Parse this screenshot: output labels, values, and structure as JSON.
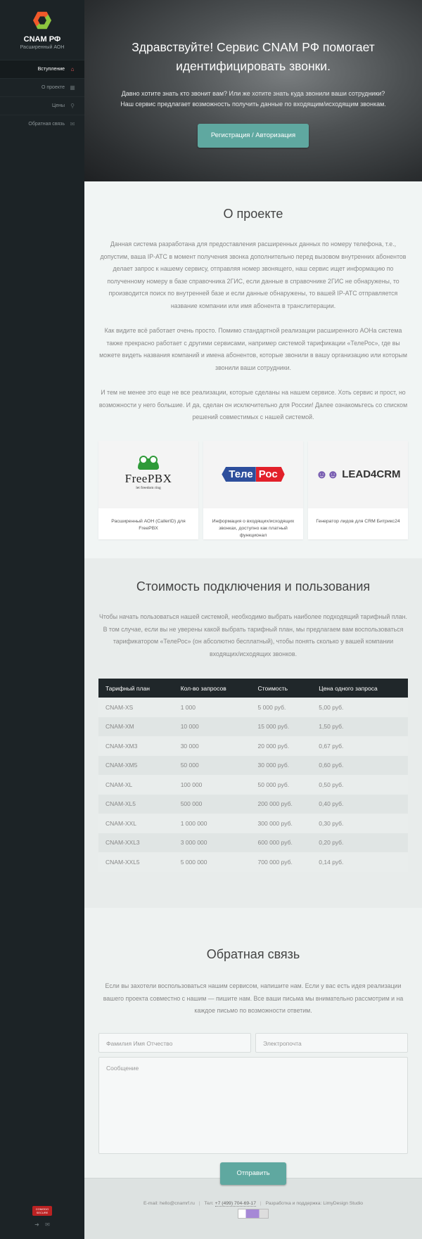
{
  "sidebar": {
    "brand": "CNAM РФ",
    "subtitle": "Расширенный АОН",
    "nav": [
      {
        "label": "Вступление",
        "icon": "home-icon"
      },
      {
        "label": "О проекте",
        "icon": "grid-icon"
      },
      {
        "label": "Цены",
        "icon": "search-icon"
      },
      {
        "label": "Обратная связь",
        "icon": "mail-icon"
      }
    ],
    "badge": "COMODO SECURE",
    "bottom_icons": [
      "login-icon",
      "mail-icon"
    ]
  },
  "hero": {
    "title": "Здравствуйте! Сервис CNAM РФ помогает идентифицировать звонки.",
    "line1": "Давно хотите знать кто звонит вам? Или же хотите знать куда звонили ваши сотрудники?",
    "line2": "Наш сервис предлагает возможность получить данные по входящим/исходящим звонкам.",
    "button": "Регистрация / Авторизация"
  },
  "about": {
    "title": "О проекте",
    "p1": "Данная система разработана для предоставления расширенных данных по номеру телефона, т.е., допустим, ваша IP-АТС в момент получения звонка дополнительно перед вызовом внутренних абонентов делает запрос к нашему сервису, отправляя номер звонящего, наш сервис ищет информацию по полученному номеру в базе справочника 2ГИС, если данные в справочнике 2ГИС не обнаружены, то производится поиск по внутренней базе и если данные обнаружены, то вашей IP-АТС отправляется название компании или имя абонента в транслитерации.",
    "p2": "Как видите всё работает очень просто. Помимо стандартной реализации расширенного АОНа система также прекрасно работает с другими сервисами, например системой тарификации «ТелеРос», где вы можете видеть названия компаний и имена абонентов, которые звонили в вашу организацию или которым звонили ваши сотрудники.",
    "p3": "И тем не менее это еще не все реализации, которые сделаны на нашем сервисе. Хоть сервис и прост, но возможности у него большие. И да, сделан он исключительно для России! Далее ознакомьтесь со списком решений совместимых с нашей системой.",
    "partners": [
      {
        "logo_name": "FreePBX",
        "logo_tag": "let freedom ring",
        "caption": "Расширенный АОН (CallerID) для FreePBX"
      },
      {
        "logo_left": "Теле",
        "logo_right": "Рос",
        "caption": "Информация о входящих/исходящих звонках, доступно как платный функционал"
      },
      {
        "logo_name": "LEAD4CRM",
        "caption": "Генератор лидов для CRM Битрикс24"
      }
    ]
  },
  "pricing": {
    "title": "Стоимость подключения и пользования",
    "intro": "Чтобы начать пользоваться нашей системой, необходимо выбрать наиболее подходящий тарифный план. В том случае, если вы не уверены какой выбрать тарифный план, мы предлагаем вам воспользоваться тарификатором «ТелеРос» (он абсолютно бесплатный), чтобы понять сколько у вашей компании входящих/исходящих звонков.",
    "headers": [
      "Тарифный план",
      "Кол-во запросов",
      "Стоимость",
      "Цена одного запроса"
    ],
    "rows": [
      [
        "CNAM-XS",
        "1 000",
        "5 000 руб.",
        "5,00 руб."
      ],
      [
        "CNAM-XM",
        "10 000",
        "15 000 руб.",
        "1,50 руб."
      ],
      [
        "CNAM-XM3",
        "30 000",
        "20 000 руб.",
        "0,67 руб."
      ],
      [
        "CNAM-XM5",
        "50 000",
        "30 000 руб.",
        "0,60 руб."
      ],
      [
        "CNAM-XL",
        "100 000",
        "50 000 руб.",
        "0,50 руб."
      ],
      [
        "CNAM-XL5",
        "500 000",
        "200 000 руб.",
        "0,40 руб."
      ],
      [
        "CNAM-XXL",
        "1 000 000",
        "300 000 руб.",
        "0,30 руб."
      ],
      [
        "CNAM-XXL3",
        "3 000 000",
        "600 000 руб.",
        "0,20 руб."
      ],
      [
        "CNAM-XXL5",
        "5 000 000",
        "700 000 руб.",
        "0,14 руб."
      ]
    ]
  },
  "contact": {
    "title": "Обратная связь",
    "intro": "Если вы захотели воспользоваться нашим сервисом, напишите нам. Если у вас есть идея реализации вашего проекта совместно с нашим — пишите нам. Все ваши письма мы внимательно рассмотрим и на каждое письмо по возможности ответим.",
    "name_placeholder": "Фамилия Имя Отчество",
    "email_placeholder": "Электропочта",
    "message_placeholder": "Сообщение",
    "submit": "Отправить"
  },
  "footer": {
    "email": "E-mail: hello@cnamrf.ru",
    "phone_label": "Тел:",
    "phone": "+7 (499) 704-69-17",
    "credits": "Разработка и поддержка: LimyDesign Studio"
  },
  "colors": {
    "accent": "#5fa8a0",
    "sidebar": "#1c2326",
    "active_icon": "#f05a5a"
  }
}
